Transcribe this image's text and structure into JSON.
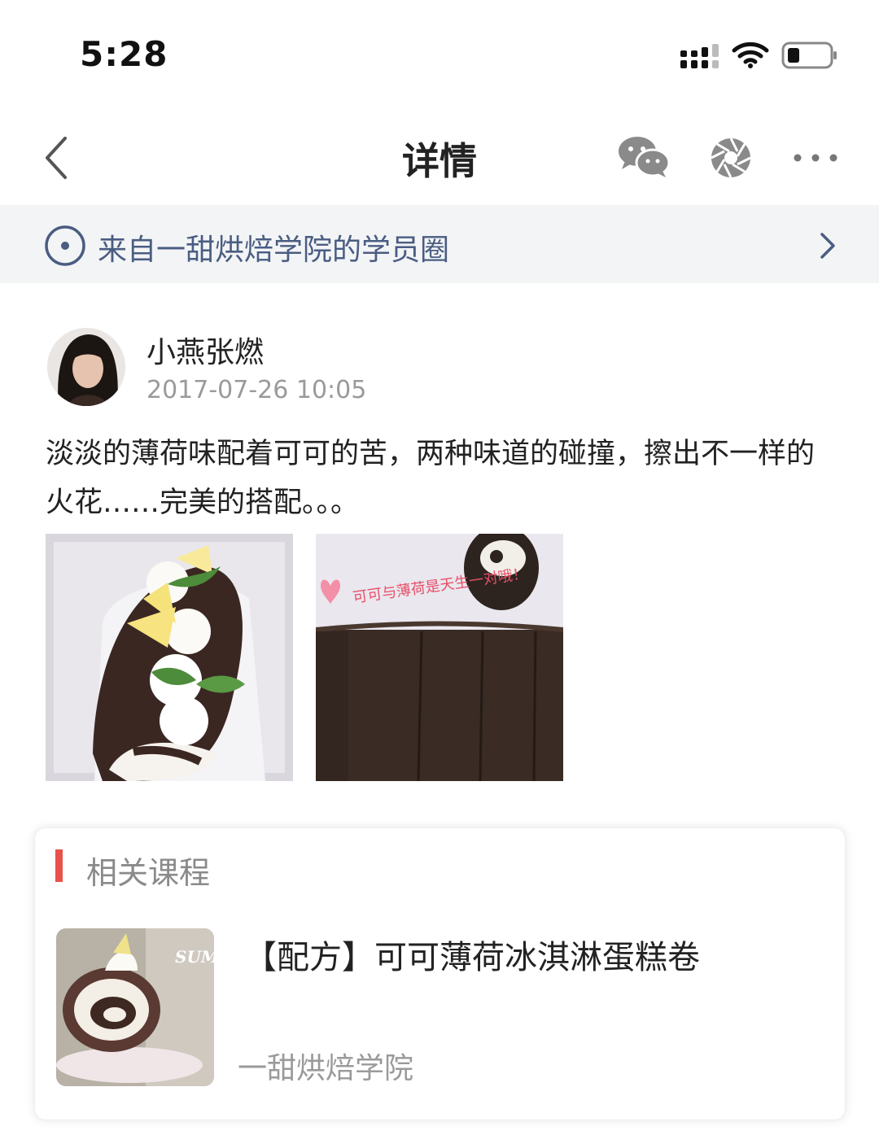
{
  "status_bar": {
    "time": "5:28"
  },
  "nav": {
    "title": "详情"
  },
  "source_banner": {
    "text": "来自一甜烘焙学院的学员圈"
  },
  "post": {
    "author": "小燕张燃",
    "timestamp": "2017-07-26 10:05",
    "text": "淡淡的薄荷味配着可可的苦，两种味道的碰撞，擦出不一样的火花……完美的搭配。。。",
    "photo2_caption": "可可与薄荷是天生一对哦！"
  },
  "related_course": {
    "heading": "相关课程",
    "title": "【配方】可可薄荷冰淇淋蛋糕卷",
    "school": "一甜烘焙学院",
    "thumb_text": "SUM"
  },
  "colors": {
    "accent": "#e8524a",
    "banner_text": "#4a5d82",
    "banner_bg": "#f3f4f6"
  }
}
